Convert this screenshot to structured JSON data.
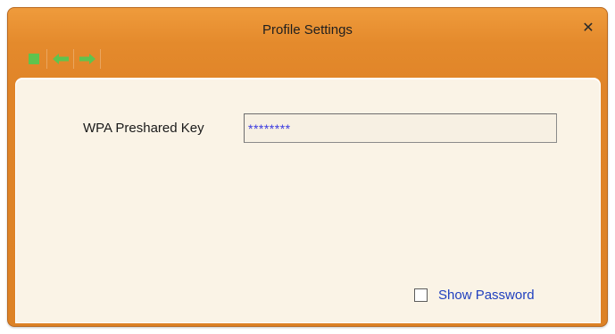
{
  "window": {
    "title": "Profile Settings",
    "close_glyph": "✕"
  },
  "toolbar": {
    "buttons": [
      {
        "icon": "stop-square-icon",
        "color": "#5fc34e"
      },
      {
        "icon": "arrow-left-icon",
        "color": "#5fc34e"
      },
      {
        "icon": "arrow-right-icon",
        "color": "#5fc34e"
      }
    ]
  },
  "form": {
    "key_label": "WPA Preshared Key",
    "key_value": "********",
    "show_password_label": "Show Password",
    "show_password_checked": false
  },
  "colors": {
    "titlebar": "#e48a2c",
    "panel": "#faf3e6",
    "link_text": "#1f3fbf",
    "masked_text": "#3a3ae0"
  }
}
